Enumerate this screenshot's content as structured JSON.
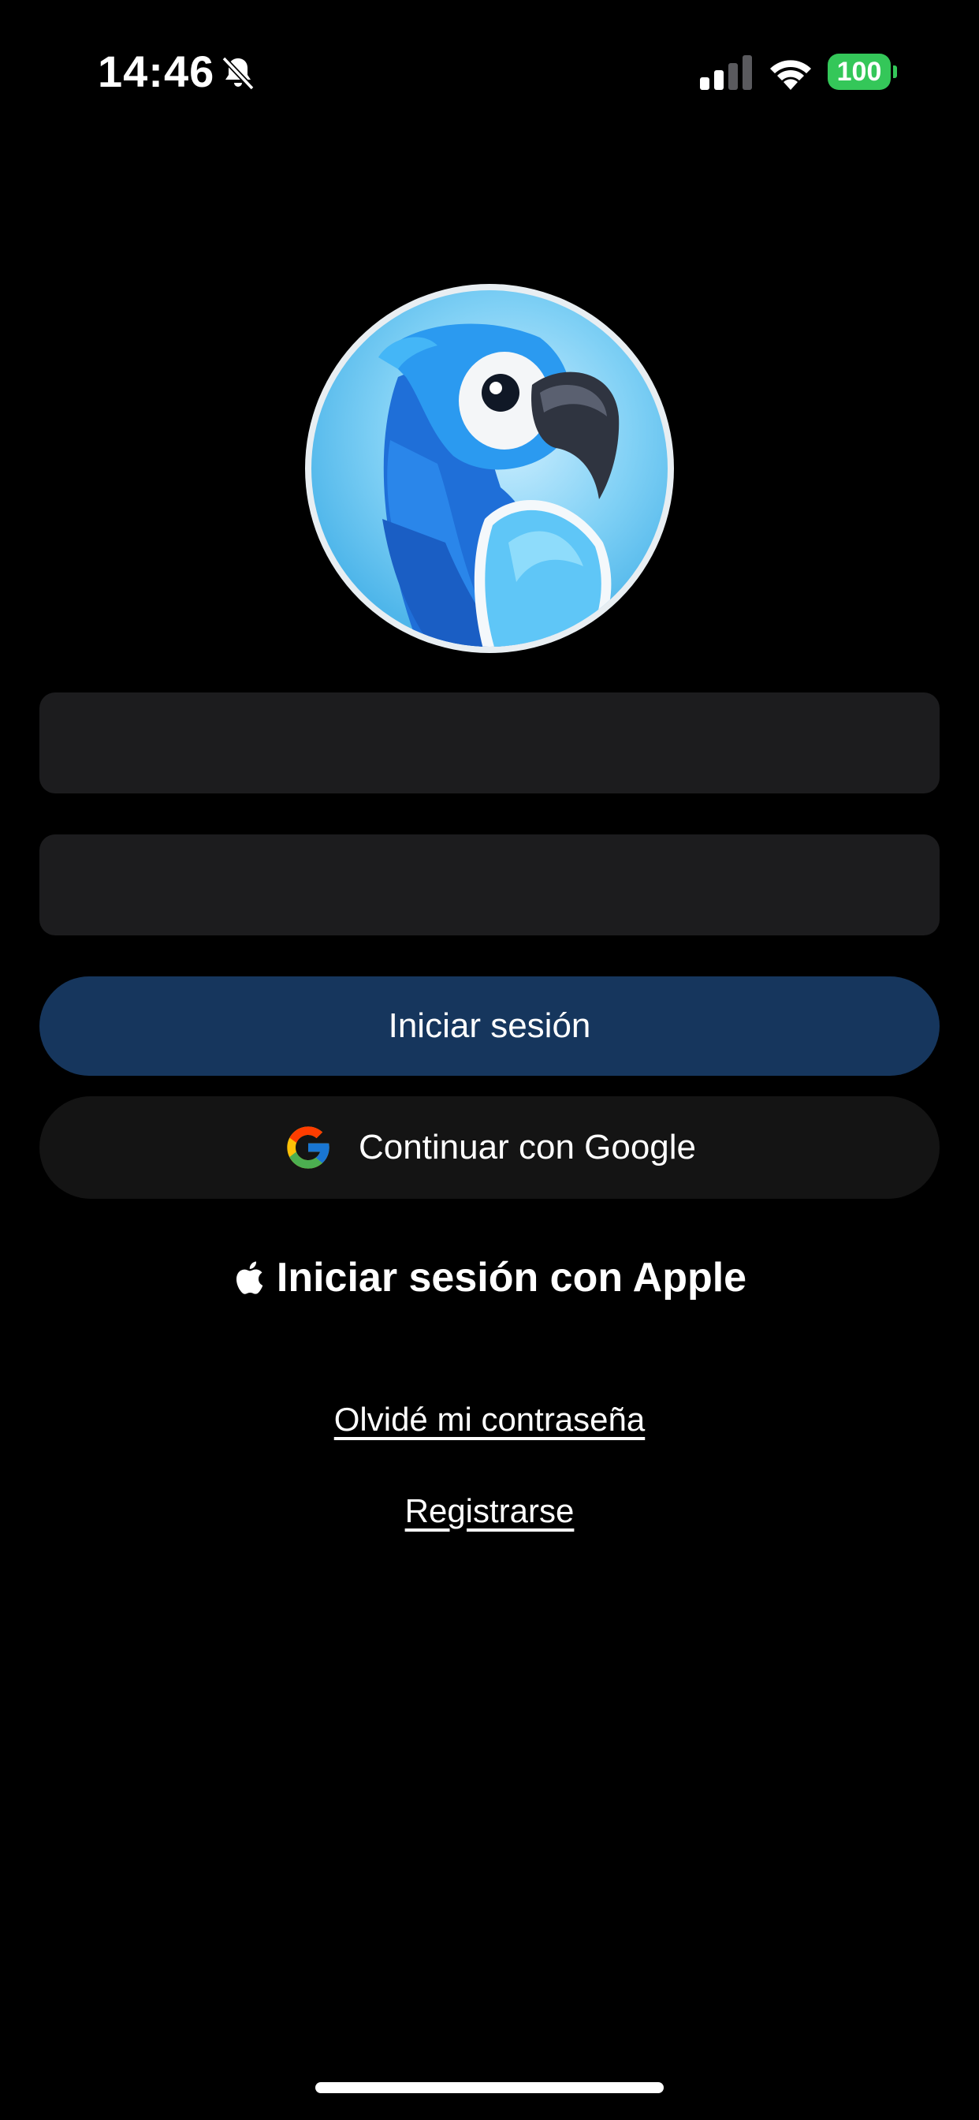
{
  "status_bar": {
    "time": "14:46",
    "battery_level": "100",
    "icons": [
      "bell-slash-icon",
      "cellular-signal-icon",
      "wifi-icon",
      "battery-icon"
    ],
    "battery_color": "#34c759"
  },
  "app": {
    "logo_icon": "parrot-logo-icon"
  },
  "form": {
    "email_placeholder": "",
    "password_placeholder": ""
  },
  "buttons": {
    "login_label": "Iniciar sesión",
    "google_label": "Continuar con Google",
    "apple_label": "Iniciar sesión con Apple"
  },
  "links": {
    "forgot_password": "Olvidé mi contraseña",
    "register": "Registrarse"
  },
  "colors": {
    "background": "#000000",
    "primary_button": "#16365d",
    "secondary_button": "#141414",
    "input_background": "#1c1c1e",
    "text": "#ffffff"
  }
}
